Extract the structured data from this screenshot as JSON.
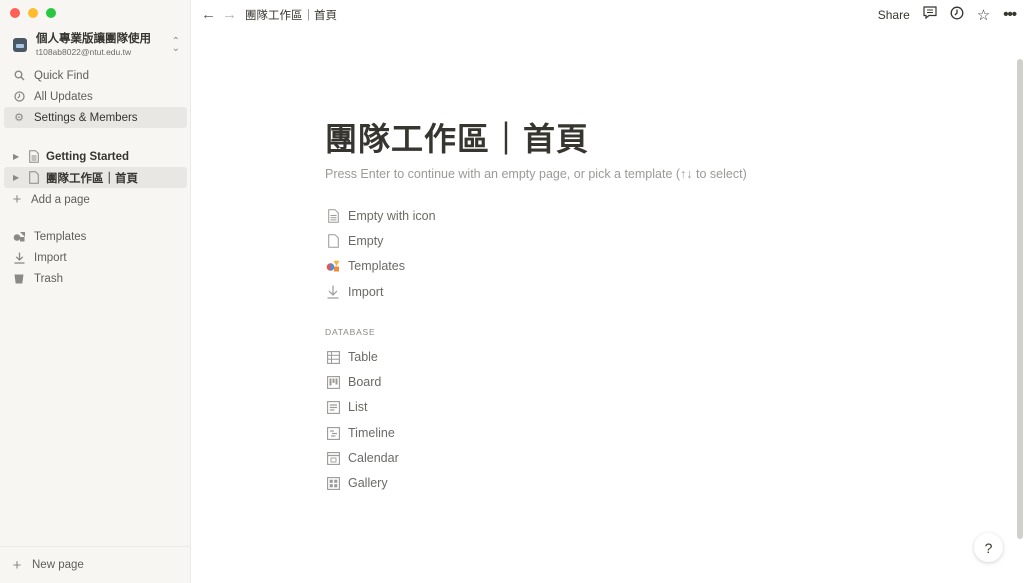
{
  "workspace": {
    "name": "個人專業版讓團隊使用",
    "email": "t108ab8022@ntut.edu.tw"
  },
  "sidebar": {
    "nav": [
      {
        "label": "Quick Find",
        "icon": "search-icon"
      },
      {
        "label": "All Updates",
        "icon": "clock-icon"
      },
      {
        "label": "Settings & Members",
        "icon": "gear-icon"
      }
    ],
    "pages": [
      {
        "label": "Getting Started",
        "icon": "page-text-icon"
      },
      {
        "label": "團隊工作區｜首頁",
        "icon": "page-icon"
      }
    ],
    "add_page": "Add a page",
    "tools": [
      {
        "label": "Templates",
        "icon": "templates-icon"
      },
      {
        "label": "Import",
        "icon": "download-icon"
      },
      {
        "label": "Trash",
        "icon": "trash-icon"
      }
    ],
    "new_page": "New page"
  },
  "topbar": {
    "breadcrumb": "團隊工作區｜首頁",
    "share": "Share",
    "icons": [
      "back-arrow-icon",
      "forward-arrow-icon",
      "comment-icon",
      "history-icon",
      "star-icon",
      "more-icon"
    ]
  },
  "page": {
    "title": "團隊工作區｜首頁",
    "hint": "Press Enter to continue with an empty page, or pick a template (↑↓ to select)",
    "options": [
      {
        "label": "Empty with icon",
        "icon": "page-text-icon"
      },
      {
        "label": "Empty",
        "icon": "page-icon"
      },
      {
        "label": "Templates",
        "icon": "templates-icon"
      },
      {
        "label": "Import",
        "icon": "download-icon"
      }
    ],
    "database_label": "DATABASE",
    "database_options": [
      {
        "label": "Table",
        "icon": "table-icon"
      },
      {
        "label": "Board",
        "icon": "board-icon"
      },
      {
        "label": "List",
        "icon": "list-icon"
      },
      {
        "label": "Timeline",
        "icon": "timeline-icon"
      },
      {
        "label": "Calendar",
        "icon": "calendar-icon"
      },
      {
        "label": "Gallery",
        "icon": "gallery-icon"
      }
    ]
  },
  "help": "?"
}
